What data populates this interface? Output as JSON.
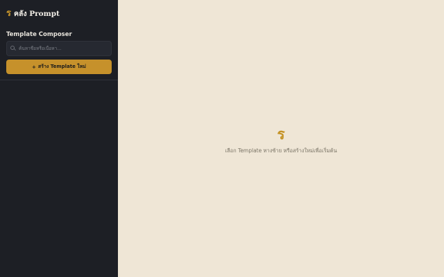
{
  "app": {
    "brand_glyph": "ร",
    "brand_title": "คลัง Prompt"
  },
  "sidebar": {
    "section_label": "Template Composer",
    "search": {
      "placeholder": "ค้นหาชื่อหรือเนื้อหา...",
      "value": ""
    },
    "create_button": {
      "icon": "+",
      "label": "สร้าง Template ใหม่"
    }
  },
  "main": {
    "empty_state": {
      "glyph": "ร",
      "message": "เลือก Template ทางซ้าย หรือสร้างใหม่เพื่อเริ่มต้น"
    }
  },
  "colors": {
    "sidebar_bg": "#1d1f25",
    "main_bg": "#efe6d6",
    "accent": "#c6912b"
  }
}
